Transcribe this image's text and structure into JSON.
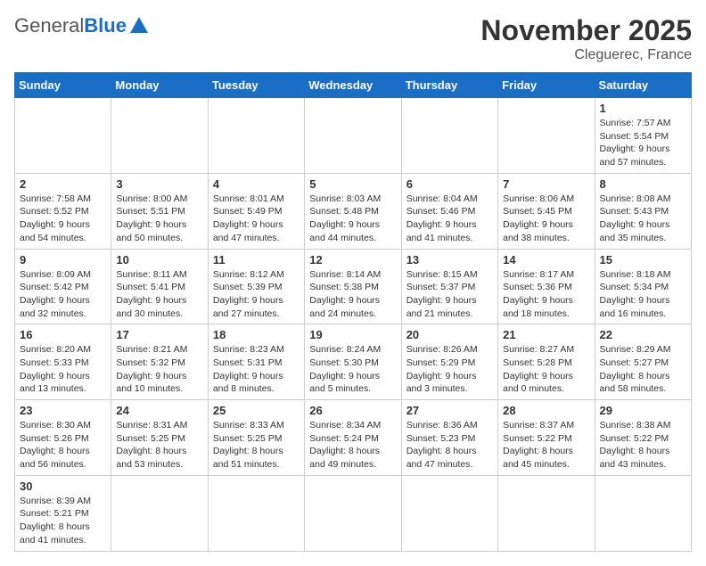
{
  "logo": {
    "general": "General",
    "blue": "Blue"
  },
  "title": "November 2025",
  "location": "Cleguerec, France",
  "headers": [
    "Sunday",
    "Monday",
    "Tuesday",
    "Wednesday",
    "Thursday",
    "Friday",
    "Saturday"
  ],
  "weeks": [
    [
      {
        "day": "",
        "info": ""
      },
      {
        "day": "",
        "info": ""
      },
      {
        "day": "",
        "info": ""
      },
      {
        "day": "",
        "info": ""
      },
      {
        "day": "",
        "info": ""
      },
      {
        "day": "",
        "info": ""
      },
      {
        "day": "1",
        "info": "Sunrise: 7:57 AM\nSunset: 5:54 PM\nDaylight: 9 hours\nand 57 minutes."
      }
    ],
    [
      {
        "day": "2",
        "info": "Sunrise: 7:58 AM\nSunset: 5:52 PM\nDaylight: 9 hours\nand 54 minutes."
      },
      {
        "day": "3",
        "info": "Sunrise: 8:00 AM\nSunset: 5:51 PM\nDaylight: 9 hours\nand 50 minutes."
      },
      {
        "day": "4",
        "info": "Sunrise: 8:01 AM\nSunset: 5:49 PM\nDaylight: 9 hours\nand 47 minutes."
      },
      {
        "day": "5",
        "info": "Sunrise: 8:03 AM\nSunset: 5:48 PM\nDaylight: 9 hours\nand 44 minutes."
      },
      {
        "day": "6",
        "info": "Sunrise: 8:04 AM\nSunset: 5:46 PM\nDaylight: 9 hours\nand 41 minutes."
      },
      {
        "day": "7",
        "info": "Sunrise: 8:06 AM\nSunset: 5:45 PM\nDaylight: 9 hours\nand 38 minutes."
      },
      {
        "day": "8",
        "info": "Sunrise: 8:08 AM\nSunset: 5:43 PM\nDaylight: 9 hours\nand 35 minutes."
      }
    ],
    [
      {
        "day": "9",
        "info": "Sunrise: 8:09 AM\nSunset: 5:42 PM\nDaylight: 9 hours\nand 32 minutes."
      },
      {
        "day": "10",
        "info": "Sunrise: 8:11 AM\nSunset: 5:41 PM\nDaylight: 9 hours\nand 30 minutes."
      },
      {
        "day": "11",
        "info": "Sunrise: 8:12 AM\nSunset: 5:39 PM\nDaylight: 9 hours\nand 27 minutes."
      },
      {
        "day": "12",
        "info": "Sunrise: 8:14 AM\nSunset: 5:38 PM\nDaylight: 9 hours\nand 24 minutes."
      },
      {
        "day": "13",
        "info": "Sunrise: 8:15 AM\nSunset: 5:37 PM\nDaylight: 9 hours\nand 21 minutes."
      },
      {
        "day": "14",
        "info": "Sunrise: 8:17 AM\nSunset: 5:36 PM\nDaylight: 9 hours\nand 18 minutes."
      },
      {
        "day": "15",
        "info": "Sunrise: 8:18 AM\nSunset: 5:34 PM\nDaylight: 9 hours\nand 16 minutes."
      }
    ],
    [
      {
        "day": "16",
        "info": "Sunrise: 8:20 AM\nSunset: 5:33 PM\nDaylight: 9 hours\nand 13 minutes."
      },
      {
        "day": "17",
        "info": "Sunrise: 8:21 AM\nSunset: 5:32 PM\nDaylight: 9 hours\nand 10 minutes."
      },
      {
        "day": "18",
        "info": "Sunrise: 8:23 AM\nSunset: 5:31 PM\nDaylight: 9 hours\nand 8 minutes."
      },
      {
        "day": "19",
        "info": "Sunrise: 8:24 AM\nSunset: 5:30 PM\nDaylight: 9 hours\nand 5 minutes."
      },
      {
        "day": "20",
        "info": "Sunrise: 8:26 AM\nSunset: 5:29 PM\nDaylight: 9 hours\nand 3 minutes."
      },
      {
        "day": "21",
        "info": "Sunrise: 8:27 AM\nSunset: 5:28 PM\nDaylight: 9 hours\nand 0 minutes."
      },
      {
        "day": "22",
        "info": "Sunrise: 8:29 AM\nSunset: 5:27 PM\nDaylight: 8 hours\nand 58 minutes."
      }
    ],
    [
      {
        "day": "23",
        "info": "Sunrise: 8:30 AM\nSunset: 5:26 PM\nDaylight: 8 hours\nand 56 minutes."
      },
      {
        "day": "24",
        "info": "Sunrise: 8:31 AM\nSunset: 5:25 PM\nDaylight: 8 hours\nand 53 minutes."
      },
      {
        "day": "25",
        "info": "Sunrise: 8:33 AM\nSunset: 5:25 PM\nDaylight: 8 hours\nand 51 minutes."
      },
      {
        "day": "26",
        "info": "Sunrise: 8:34 AM\nSunset: 5:24 PM\nDaylight: 8 hours\nand 49 minutes."
      },
      {
        "day": "27",
        "info": "Sunrise: 8:36 AM\nSunset: 5:23 PM\nDaylight: 8 hours\nand 47 minutes."
      },
      {
        "day": "28",
        "info": "Sunrise: 8:37 AM\nSunset: 5:22 PM\nDaylight: 8 hours\nand 45 minutes."
      },
      {
        "day": "29",
        "info": "Sunrise: 8:38 AM\nSunset: 5:22 PM\nDaylight: 8 hours\nand 43 minutes."
      }
    ],
    [
      {
        "day": "30",
        "info": "Sunrise: 8:39 AM\nSunset: 5:21 PM\nDaylight: 8 hours\nand 41 minutes."
      },
      {
        "day": "",
        "info": ""
      },
      {
        "day": "",
        "info": ""
      },
      {
        "day": "",
        "info": ""
      },
      {
        "day": "",
        "info": ""
      },
      {
        "day": "",
        "info": ""
      },
      {
        "day": "",
        "info": ""
      }
    ]
  ]
}
